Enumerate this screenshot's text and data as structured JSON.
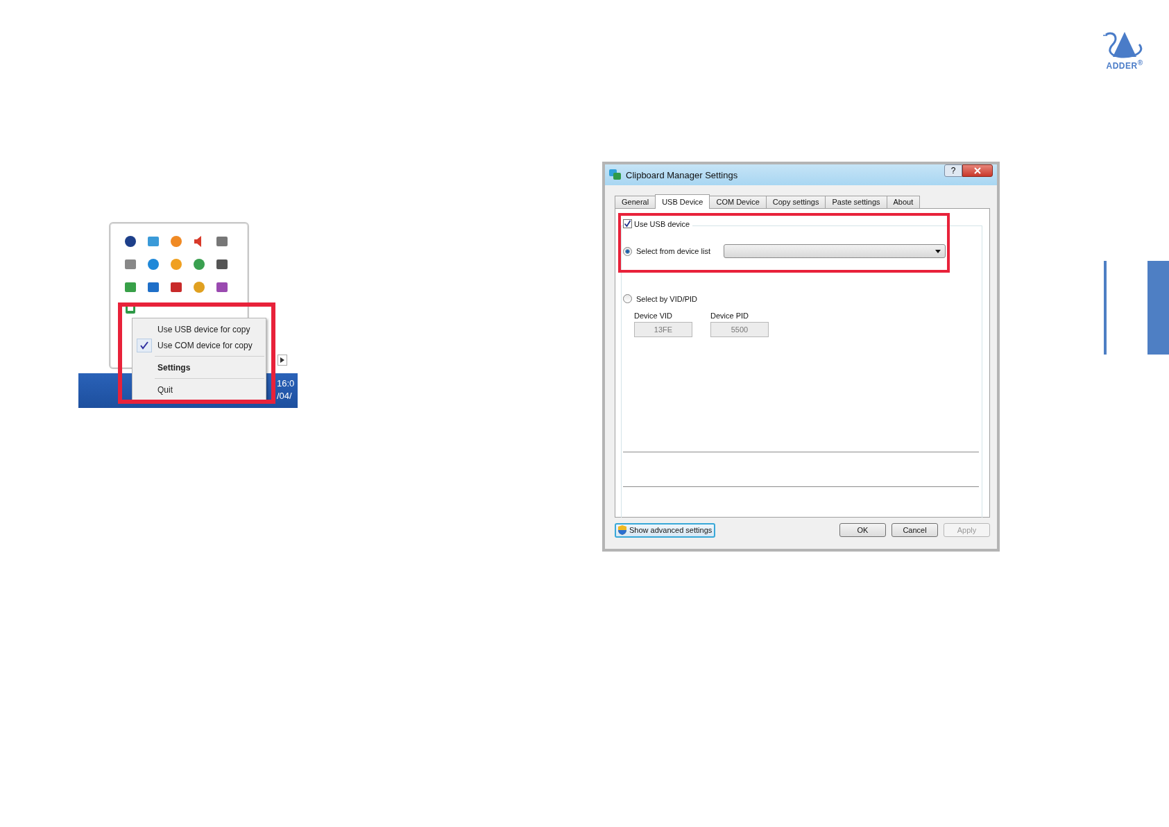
{
  "brand": {
    "name": "ADDER$^{®}$"
  },
  "tray": {
    "clock_time": "16:0",
    "clock_date": "/04/",
    "menu": [
      {
        "kind": "item",
        "label": "Use USB device for copy",
        "checked": false,
        "bold": false
      },
      {
        "kind": "item",
        "label": "Use COM device for copy",
        "checked": true,
        "bold": false
      },
      {
        "kind": "separator"
      },
      {
        "kind": "item",
        "label": "Settings",
        "checked": false,
        "bold": true
      },
      {
        "kind": "separator"
      },
      {
        "kind": "item",
        "label": "Quit",
        "checked": false,
        "bold": false
      }
    ]
  },
  "dialog": {
    "title": "Clipboard Manager Settings",
    "help_button": "?",
    "tabs": [
      {
        "label": "General",
        "selected": false
      },
      {
        "label": "USB Device",
        "selected": true
      },
      {
        "label": "COM Device",
        "selected": false
      },
      {
        "label": "Copy settings",
        "selected": false
      },
      {
        "label": "Paste settings",
        "selected": false
      },
      {
        "label": "About",
        "selected": false
      }
    ],
    "use_usb": {
      "label": "Use USB device",
      "checked": true
    },
    "options": [
      {
        "label": "Select from device list",
        "selected": true
      },
      {
        "label": "Select by VID/PID",
        "selected": false
      }
    ],
    "fields": [
      {
        "label": "Device VID",
        "value": "13FE",
        "disabled": true
      },
      {
        "label": "Device PID",
        "value": "5500",
        "disabled": true
      }
    ],
    "advanced_button": "Show advanced settings",
    "buttons": [
      {
        "label": "OK",
        "disabled": false
      },
      {
        "label": "Cancel",
        "disabled": false
      },
      {
        "label": "Apply",
        "disabled": true
      }
    ]
  }
}
